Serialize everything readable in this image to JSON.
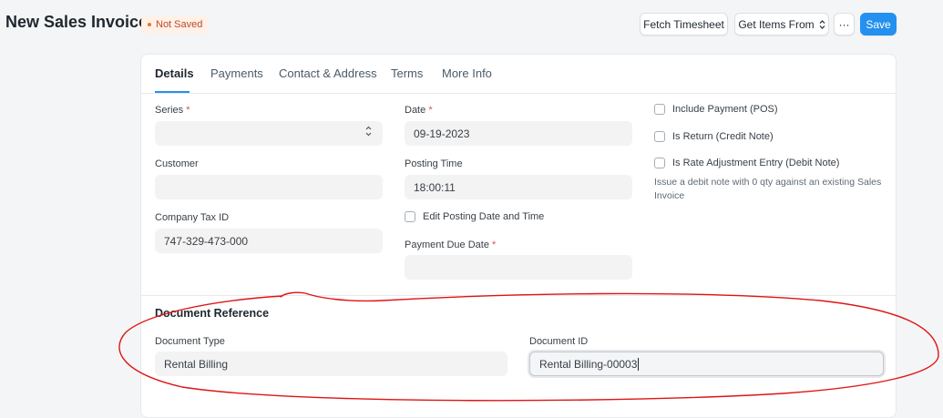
{
  "header": {
    "title": "New Sales Invoice",
    "status": "Not Saved",
    "buttons": {
      "fetch_timesheet": "Fetch Timesheet",
      "get_items_from": "Get Items From",
      "more": "···",
      "save": "Save"
    }
  },
  "tabs": [
    "Details",
    "Payments",
    "Contact & Address",
    "Terms",
    "More Info"
  ],
  "form": {
    "series": {
      "label": "Series",
      "value": ""
    },
    "customer": {
      "label": "Customer",
      "value": ""
    },
    "company_tax_id": {
      "label": "Company Tax ID",
      "value": "747-329-473-000"
    },
    "date": {
      "label": "Date",
      "value": "09-19-2023"
    },
    "posting_time": {
      "label": "Posting Time",
      "value": "18:00:11"
    },
    "edit_posting": {
      "label": "Edit Posting Date and Time",
      "checked": false
    },
    "payment_due_date": {
      "label": "Payment Due Date",
      "value": ""
    },
    "include_payment": {
      "label": "Include Payment (POS)",
      "checked": false
    },
    "is_return": {
      "label": "Is Return (Credit Note)",
      "checked": false
    },
    "is_rate_adjustment": {
      "label": "Is Rate Adjustment Entry (Debit Note)",
      "checked": false
    },
    "rate_adjustment_desc": "Issue a debit note with 0 qty against an existing Sales Invoice"
  },
  "document_reference": {
    "title": "Document Reference",
    "document_type": {
      "label": "Document Type",
      "value": "Rental Billing"
    },
    "document_id": {
      "label": "Document ID",
      "value": "Rental Billing-00003"
    }
  },
  "colors": {
    "accent": "#2490ef",
    "annotation": "#e01414",
    "required": "#e24c4c"
  }
}
